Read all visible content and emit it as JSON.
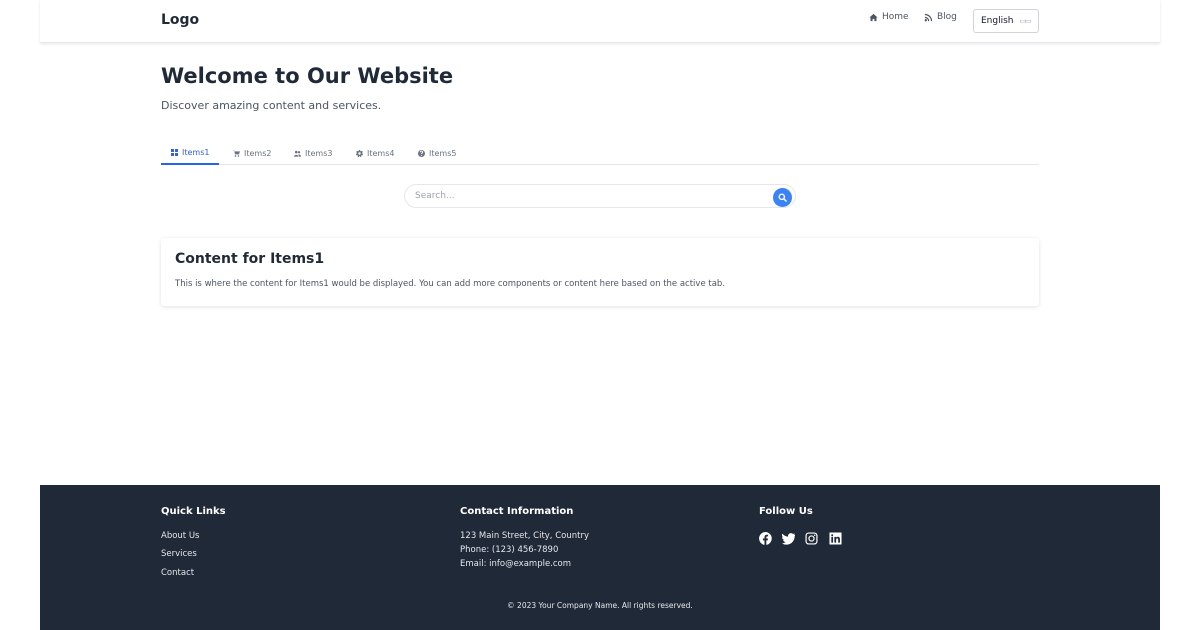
{
  "header": {
    "logo": "Logo",
    "nav": [
      {
        "label": "Home",
        "icon": "home-icon"
      },
      {
        "label": "Blog",
        "icon": "blog-icon"
      }
    ],
    "language": {
      "selected": "English",
      "flag": "flag-icon"
    }
  },
  "hero": {
    "title": "Welcome to Our Website",
    "subtitle": "Discover amazing content and services."
  },
  "tabs": [
    {
      "label": "Items1",
      "icon": "grid-icon",
      "active": true
    },
    {
      "label": "Items2",
      "icon": "cart-icon",
      "active": false
    },
    {
      "label": "Items3",
      "icon": "users-icon",
      "active": false
    },
    {
      "label": "Items4",
      "icon": "gear-icon",
      "active": false
    },
    {
      "label": "Items5",
      "icon": "help-icon",
      "active": false
    }
  ],
  "search": {
    "placeholder": "Search...",
    "value": ""
  },
  "content": {
    "title": "Content for Items1",
    "body": "This is where the content for Items1 would be displayed. You can add more components or content here based on the active tab."
  },
  "footer": {
    "quick_links": {
      "heading": "Quick Links",
      "items": [
        "About Us",
        "Services",
        "Contact"
      ]
    },
    "contact": {
      "heading": "Contact Information",
      "address": "123 Main Street, City, Country",
      "phone": "Phone: (123) 456-7890",
      "email": "Email: info@example.com"
    },
    "follow": {
      "heading": "Follow Us",
      "icons": [
        "facebook-icon",
        "twitter-icon",
        "instagram-icon",
        "linkedin-icon"
      ]
    },
    "copyright": "© 2023 Your Company Name. All rights reserved."
  },
  "colors": {
    "accent": "#3b82f6",
    "active_tab": "#2563eb",
    "footer_bg": "#1f2937",
    "text": "#1f2937"
  }
}
